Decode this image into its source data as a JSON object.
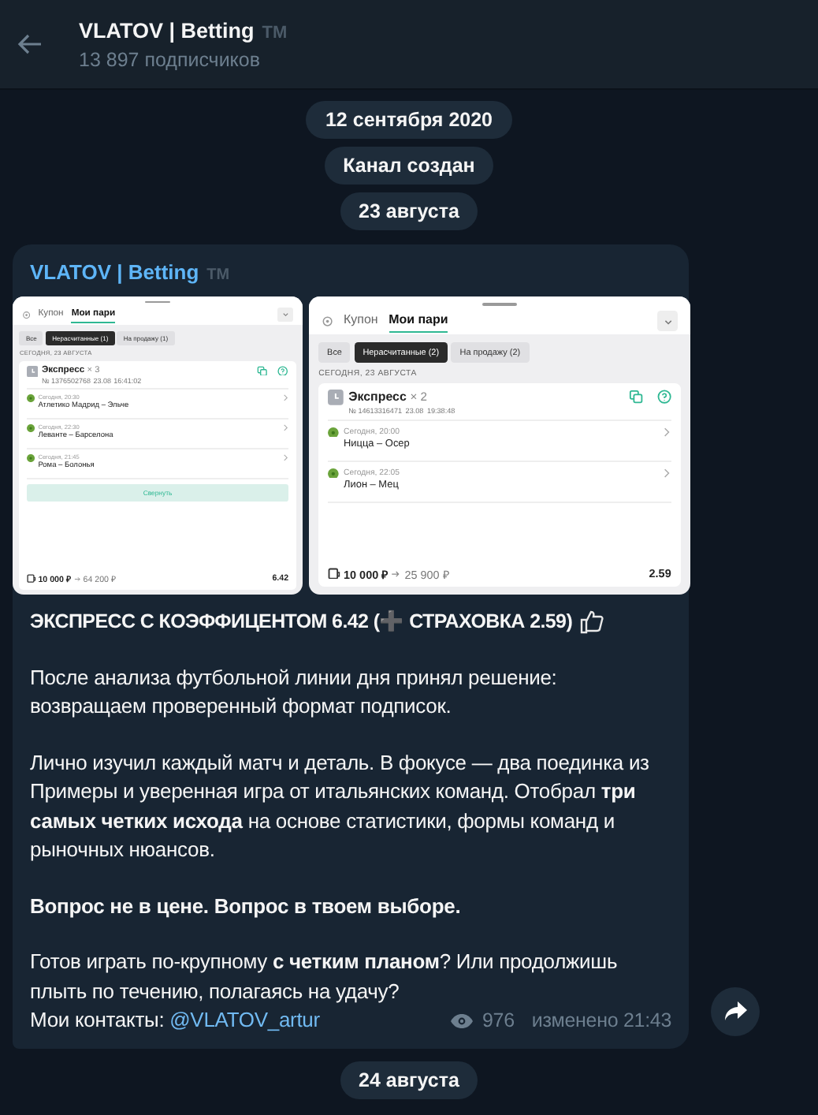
{
  "header": {
    "title": "VLATOV | Betting",
    "badge": "TM",
    "subtitle": "13 897 подписчиков"
  },
  "service_messages": [
    "12 сентября 2020",
    "Канал создан",
    "23 августа"
  ],
  "post": {
    "author": "VLATOV | Betting",
    "author_badge": "TM",
    "screenshots": [
      {
        "tabs": [
          {
            "label": "Купон",
            "selected": false
          },
          {
            "label": "Мои пари",
            "selected": true
          }
        ],
        "filters": [
          {
            "label": "Все",
            "selected": false
          },
          {
            "label": "Нерасчитанные (1)",
            "selected": true
          },
          {
            "label": "На продажу (1)",
            "selected": false
          }
        ],
        "date_heading": "СЕГОДНЯ, 23 АВГУСТА",
        "bet_title": "Экспресс",
        "bet_count": "× 3",
        "bet_number": "№ 1376502768",
        "bet_date": "23.08",
        "bet_time": "16:41:02",
        "events": [
          {
            "time": "Сегодня, 20:30",
            "match": "Атлетико Мадрид – Эльче"
          },
          {
            "time": "Сегодня, 22:30",
            "match": "Леванте – Барселона"
          },
          {
            "time": "Сегодня, 21:45",
            "match": "Рома – Болонья"
          }
        ],
        "collapse_button": "Свернуть",
        "stake": "10 000 ₽",
        "payout": "64 200 ₽",
        "odds": "6.42"
      },
      {
        "tabs": [
          {
            "label": "Купон",
            "selected": false
          },
          {
            "label": "Мои пари",
            "selected": true
          }
        ],
        "filters": [
          {
            "label": "Все",
            "selected": false
          },
          {
            "label": "Нерасчитанные (2)",
            "selected": true
          },
          {
            "label": "На продажу (2)",
            "selected": false
          }
        ],
        "date_heading": "СЕГОДНЯ, 23 АВГУСТА",
        "bet_title": "Экспресс",
        "bet_count": "× 2",
        "bet_number": "№ 14613316471",
        "bet_date": "23.08",
        "bet_time": "19:38:48",
        "events": [
          {
            "time": "Сегодня, 20:00",
            "match": "Ницца – Осер"
          },
          {
            "time": "Сегодня, 22:05",
            "match": "Лион – Мец"
          }
        ],
        "stake": "10 000 ₽",
        "payout": "25 900 ₽",
        "odds": "2.59"
      }
    ],
    "headline": "ЭКСПРЕСС С КОЭФФИЦЕНТОМ 6.42 (➕ СТРАХОВКА 2.59)",
    "paragraphs": [
      {
        "kind": "normal",
        "text": "После анализа футбольной линии дня принял решение: возвращаем проверенный формат подписок."
      },
      {
        "kind": "normal",
        "text": "Лично изучил каждый матч и деталь. В фокусе — два поединка из Примеры и уверенная игра от итальянских команд. Отобрал **три самых четких исхода** на основе статистики, формы команд и рыночных нюансов."
      },
      {
        "kind": "bold",
        "text": "Вопрос не в цене. Вопрос в твоем выборе."
      },
      {
        "kind": "normal",
        "text": "Готов играть по-крупному **с четким планом**? Или продолжишь плыть по течению, полагаясь на удачу?"
      }
    ],
    "contacts_label": "Мои контакты:",
    "contacts_link": "@VLATOV_artur",
    "views": "976",
    "edited": "изменено 21:43"
  },
  "next_date": "24 августа"
}
